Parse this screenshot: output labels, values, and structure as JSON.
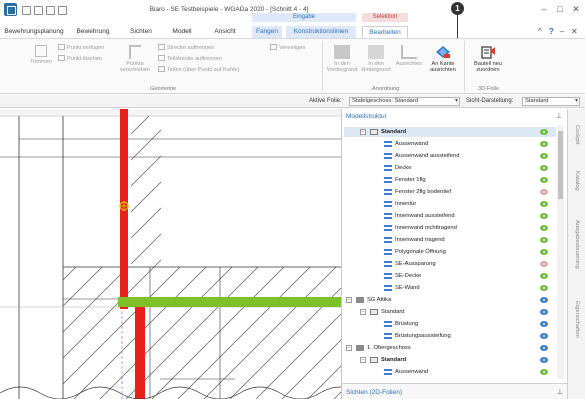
{
  "window": {
    "title": "Biaro - SE Testbeispiele - WGADa 2020 - [Schnitt 4 - 4]",
    "callout_number": "1",
    "context_groups": {
      "editing": "Eingabe",
      "selection": "Selektion"
    }
  },
  "tabs": [
    "Bewehrungsplanung",
    "Bewehrung",
    "Sichten",
    "Modell",
    "Ansicht",
    "Fangen",
    "Konstruktionslinien",
    "Bearbeiten"
  ],
  "ribbon": {
    "items": [
      "Trimmen",
      "Punkt einfügen",
      "Punkt löschen",
      "Punkte verschieben",
      "Strecke auftrennen",
      "Teilstrecke auftrennen",
      "Teilen (über Punkt auf Kante)",
      "Vereinigen",
      "In den Vordergrund",
      "In den Hintergrund",
      "Ausrichten",
      "An Kante ausrichten",
      "Bauteil neu zuordnen"
    ],
    "groups": {
      "geometry": "Geometrie",
      "arrangement": "Anordnung",
      "foils": "3D-Folie"
    }
  },
  "propbar": {
    "active_foil_label": "Aktive Folie:",
    "active_foil_value": "Stafelgeschoss: Standard",
    "view_label": "Sicht-Darstellung:",
    "view_value": "Standard"
  },
  "panel": {
    "title": "Modellstruktur",
    "footer_title": "Sichten (2D-Folien)",
    "tree": [
      {
        "label": "Standard",
        "level": 1,
        "kind": "model",
        "selected": true,
        "bold": true,
        "visible": "on"
      },
      {
        "label": "Aussenwand",
        "level": 2,
        "kind": "list",
        "visible": "on"
      },
      {
        "label": "Aussenwand aussteifend",
        "level": 2,
        "kind": "list",
        "visible": "on"
      },
      {
        "label": "Decke",
        "level": 2,
        "kind": "list",
        "visible": "on"
      },
      {
        "label": "Fenster 1flg",
        "level": 2,
        "kind": "list",
        "visible": "on"
      },
      {
        "label": "Fenster 2flg bodentief",
        "level": 2,
        "kind": "list",
        "visible": "off"
      },
      {
        "label": "Innentür",
        "level": 2,
        "kind": "list",
        "visible": "on"
      },
      {
        "label": "Innenwand aussteifend",
        "level": 2,
        "kind": "list",
        "visible": "on"
      },
      {
        "label": "Innenwand nichttragend",
        "level": 2,
        "kind": "list",
        "visible": "on"
      },
      {
        "label": "Innenwand tragend",
        "level": 2,
        "kind": "list",
        "visible": "on"
      },
      {
        "label": "Polygonale Öffnung",
        "level": 2,
        "kind": "list",
        "visible": "on"
      },
      {
        "label": "SE-Aussparung",
        "level": 2,
        "kind": "list",
        "visible": "off"
      },
      {
        "label": "SE-Decke",
        "level": 2,
        "kind": "list",
        "visible": "on"
      },
      {
        "label": "SE-Wand",
        "level": 2,
        "kind": "list",
        "visible": "on"
      },
      {
        "label": "SG Attika",
        "level": 0,
        "kind": "floor",
        "visible": "on-blue"
      },
      {
        "label": "Standard",
        "level": 1,
        "kind": "model",
        "visible": "on-blue"
      },
      {
        "label": "Brüstung",
        "level": 2,
        "kind": "list",
        "visible": "on-blue"
      },
      {
        "label": "Brüstungsaussteifung",
        "level": 2,
        "kind": "list",
        "visible": "on-blue"
      },
      {
        "label": "1. Obergeschoss",
        "level": 0,
        "kind": "floor",
        "visible": "on-blue"
      },
      {
        "label": "Standard",
        "level": 1,
        "kind": "model",
        "bold": true,
        "visible": "on-blue"
      },
      {
        "label": "Aussenwand",
        "level": 2,
        "kind": "list",
        "visible": "on"
      }
    ]
  },
  "side_tabs": [
    "Cockpit",
    "Katalog",
    "Ausgabesteuerung",
    "Eigenschaften"
  ],
  "colors": {
    "accent": "#2a70c0",
    "wall_red": "#e8201a",
    "slab_green": "#7fbf2a",
    "visible_green": "#6fbf3a",
    "hidden_red": "#d7a6a6"
  }
}
